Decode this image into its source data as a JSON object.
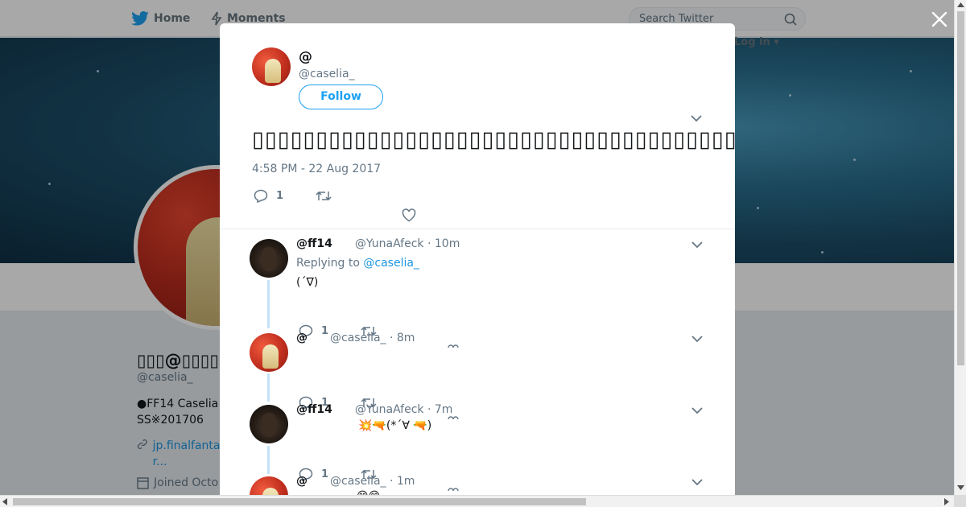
{
  "topbar": {
    "home_label": "Home",
    "moments_label": "Moments",
    "search_placeholder": "Search Twitter",
    "login_label": "Log in"
  },
  "profile": {
    "display_name": "▯▯▯@▯▯▯▯",
    "handle": "@caselia_",
    "bio": "●FF14 Caselia SS※201706",
    "link": "jp.finalfanta r...",
    "joined": "Joined Octo"
  },
  "modal": {
    "author_name": "@",
    "author_handle": "@caselia_",
    "follow_label": "Follow",
    "tweet_text": "▯▯▯▯▯▯▯▯▯▯▯▯▯▯▯▯▯▯▯▯▯▯▯▯▯▯▯▯▯▯▯▯▯▯▯▯▯▯▯▯▯▯▯▯▯▯▯▯▯▯▯▯▯▯▯▯▯▯▯…▯▯▯▯▯▯",
    "timestamp": "4:58 PM - 22 Aug 2017",
    "reply_count": "1"
  },
  "replies": [
    {
      "name": "@ff14",
      "handle": "@YunaAfeck",
      "time": "· 10m",
      "replying_prefix": "Replying to",
      "replying_to": "@caselia_",
      "text": "(´∇)",
      "reply_count": "1"
    },
    {
      "name": "@",
      "handle": "@caselia_",
      "time": "· 8m",
      "text": "",
      "reply_count": "1"
    },
    {
      "name": "@ff14",
      "handle": "@YunaAfeck",
      "time": "· 7m",
      "text": "💥🔫(*´∀ 🔫)",
      "reply_count": "1"
    },
    {
      "name": "@",
      "handle": "@caselia_",
      "time": "· 1m",
      "text": "😊😊"
    }
  ],
  "icons": {
    "twitter_bird": "twitter-bird-icon",
    "moments": "lightning-icon",
    "search": "magnifier-icon",
    "close": "close-icon",
    "reply": "reply-icon",
    "retweet": "retweet-icon",
    "like": "heart-icon",
    "chevron": "chevron-down-icon",
    "link": "link-icon",
    "calendar": "calendar-icon"
  },
  "colors": {
    "accent": "#1da1f2",
    "link": "#1b95e0",
    "muted": "#657786",
    "thread_line": "#c4e2f8"
  }
}
